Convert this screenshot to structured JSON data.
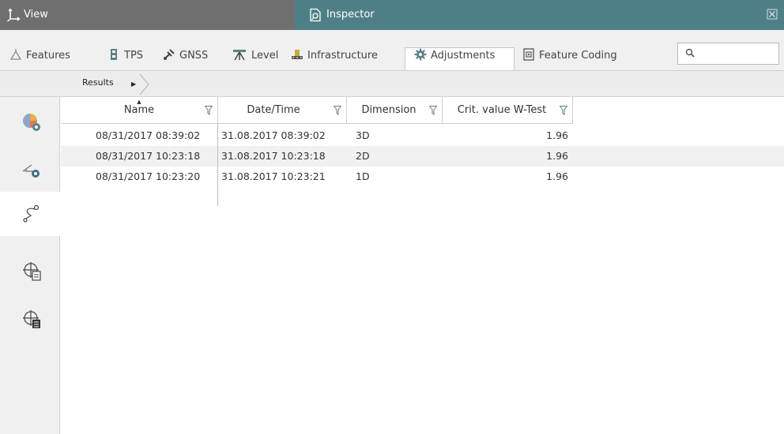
{
  "window": {
    "left_title": "View",
    "right_title": "Inspector",
    "title_left_color": "#6f6f6f",
    "title_right_color": "#4f7f86"
  },
  "tabs": [
    {
      "label": "Features",
      "icon": "features-icon"
    },
    {
      "label": "TPS",
      "icon": "tps-icon"
    },
    {
      "label": "GNSS",
      "icon": "gnss-icon"
    },
    {
      "label": "Level",
      "icon": "level-icon"
    },
    {
      "label": "Infrastructure",
      "icon": "infrastructure-icon"
    },
    {
      "label": "Adjustments",
      "icon": "gear-icon",
      "active": true
    },
    {
      "label": "Feature Coding",
      "icon": "feature-coding-icon"
    }
  ],
  "search": {
    "value": "",
    "placeholder": ""
  },
  "breadcrumb": {
    "label": "Results"
  },
  "sidebar": {
    "items": [
      {
        "icon": "chart-settings-icon"
      },
      {
        "icon": "measure-settings-icon"
      },
      {
        "icon": "network-icon",
        "active": true
      },
      {
        "icon": "crosshair-doc-icon"
      },
      {
        "icon": "crosshair-list-icon"
      }
    ]
  },
  "table": {
    "columns": [
      "Name",
      "Date/Time",
      "Dimension",
      "Crit. value W-Test"
    ],
    "sort_column": "Name",
    "rows": [
      {
        "name": "08/31/2017 08:39:02",
        "datetime": "31.08.2017 08:39:02",
        "dimension": "3D",
        "crit": "1.96"
      },
      {
        "name": "08/31/2017 10:23:18",
        "datetime": "31.08.2017 10:23:18",
        "dimension": "2D",
        "crit": "1.96"
      },
      {
        "name": "08/31/2017 10:23:20",
        "datetime": "31.08.2017 10:23:21",
        "dimension": "1D",
        "crit": "1.96"
      }
    ]
  }
}
